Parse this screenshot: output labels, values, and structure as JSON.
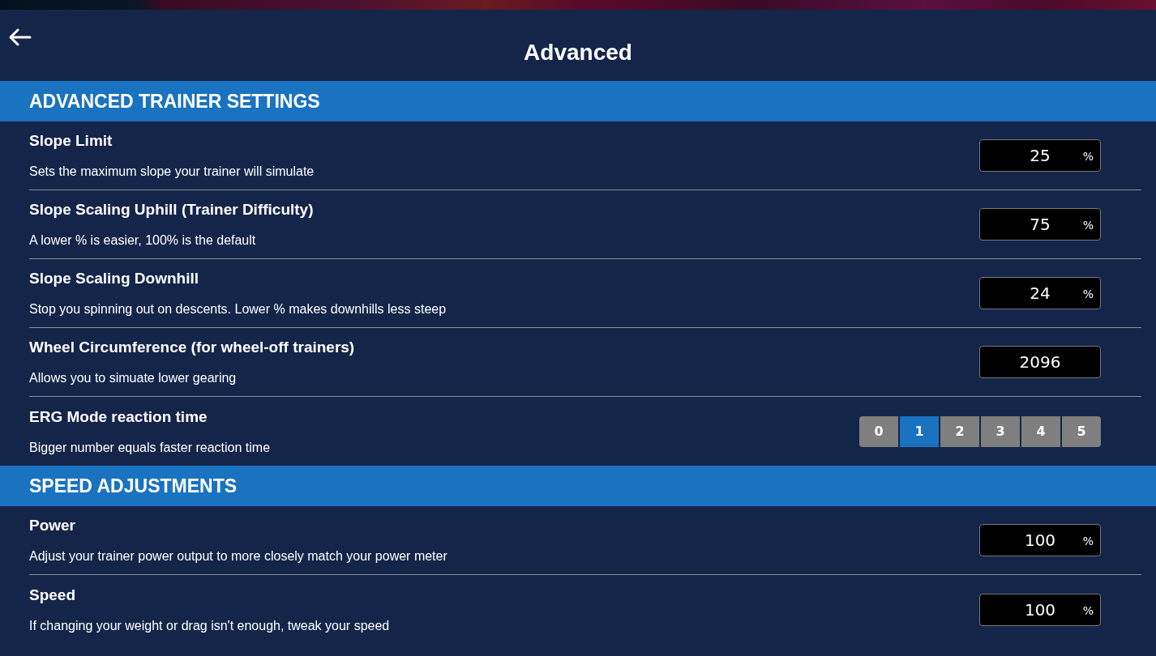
{
  "header": {
    "title": "Advanced"
  },
  "sections": [
    {
      "title": "ADVANCED TRAINER SETTINGS",
      "rows": [
        {
          "kind": "number",
          "label": "Slope Limit",
          "description": "Sets the maximum slope your trainer will simulate",
          "value": "25",
          "unit": "%"
        },
        {
          "kind": "number",
          "label": "Slope Scaling Uphill (Trainer Difficulty)",
          "description": "A lower % is easier, 100% is the default",
          "value": "75",
          "unit": "%"
        },
        {
          "kind": "number",
          "label": "Slope Scaling Downhill",
          "description": "Stop you spinning out on descents. Lower % makes downhills less steep",
          "value": "24",
          "unit": "%"
        },
        {
          "kind": "number",
          "label": "Wheel Circumference (for wheel-off trainers)",
          "description": "Allows you to simuate lower gearing",
          "value": "2096"
        },
        {
          "kind": "segmented",
          "label": "ERG Mode reaction time",
          "description": "Bigger number equals faster reaction time",
          "options": [
            {
              "label": "0",
              "selected": false
            },
            {
              "label": "1",
              "selected": true
            },
            {
              "label": "2",
              "selected": false
            },
            {
              "label": "3",
              "selected": false
            },
            {
              "label": "4",
              "selected": false
            },
            {
              "label": "5",
              "selected": false
            }
          ]
        }
      ]
    },
    {
      "title": "SPEED ADJUSTMENTS",
      "rows": [
        {
          "kind": "number",
          "label": "Power",
          "description": "Adjust your trainer power output to more closely match your power meter",
          "value": "100",
          "unit": "%"
        },
        {
          "kind": "number",
          "label": "Speed",
          "description": "If changing your weight or drag isn't enough, tweak your speed",
          "value": "100",
          "unit": "%"
        }
      ]
    }
  ]
}
